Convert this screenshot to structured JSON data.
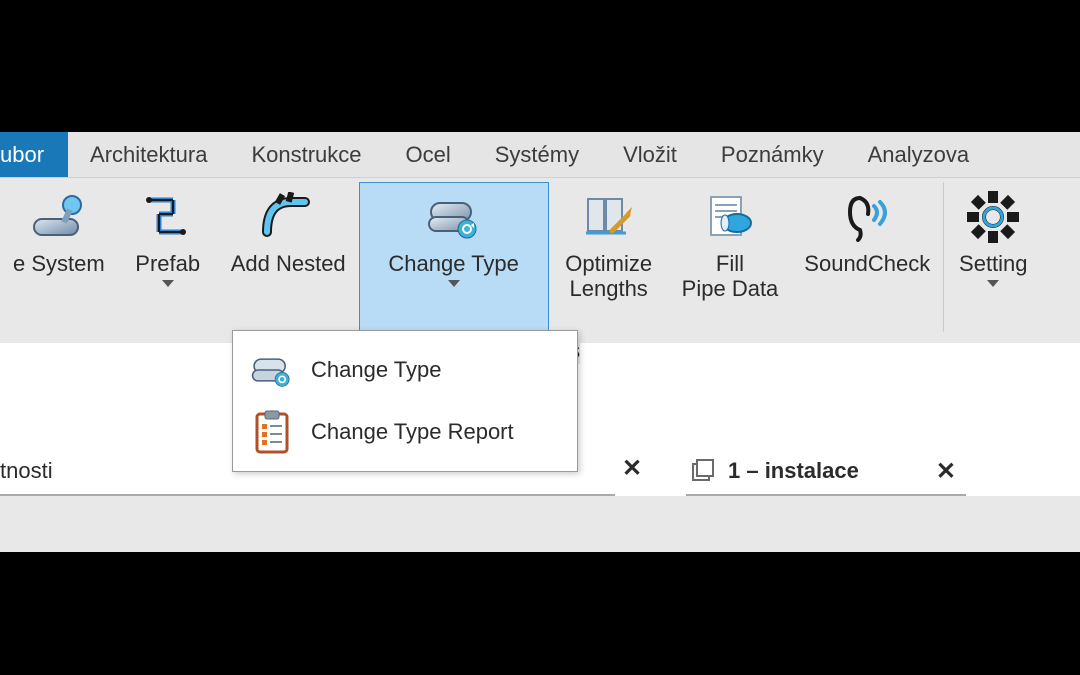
{
  "tabs": {
    "active": "ubor",
    "items": [
      "ubor",
      "Architektura",
      "Konstrukce",
      "Ocel",
      "Systémy",
      "Vložit",
      "Poznámky",
      "Analyzova"
    ]
  },
  "ribbon": {
    "group_label": "ols",
    "buttons": [
      {
        "label": "e System",
        "has_caret": false
      },
      {
        "label": "Prefab",
        "has_caret": true
      },
      {
        "label": "Add Nested",
        "has_caret": false
      },
      {
        "label": "Change Type",
        "has_caret": true,
        "pressed": true
      },
      {
        "label": "Optimize\nLengths",
        "has_caret": false
      },
      {
        "label": "Fill\nPipe Data",
        "has_caret": false
      },
      {
        "label": "SoundCheck",
        "has_caret": false
      },
      {
        "label": "Setting",
        "has_caret": true
      }
    ]
  },
  "dropdown": {
    "items": [
      {
        "label": "Change Type"
      },
      {
        "label": "Change Type Report"
      }
    ]
  },
  "panels": {
    "left_label": "tnosti",
    "doc_tab_label": "1 – instalace"
  }
}
